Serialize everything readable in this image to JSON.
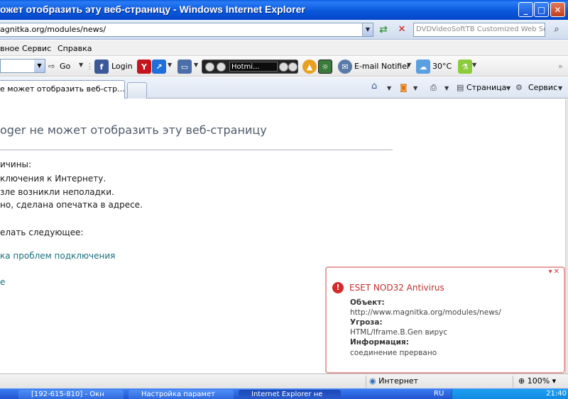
{
  "window": {
    "title": "ожет отобразить эту веб-страницу - Windows Internet Explorer",
    "minimize": "_",
    "maximize": "□",
    "close": "✕"
  },
  "address_bar": {
    "url": "agnitka.org/modules/news/",
    "search_placeholder": "DVDVideoSoftTB Customized Web Search"
  },
  "menu": {
    "items": [
      "вное",
      "Сервис",
      "Справка"
    ]
  },
  "toolbar": {
    "go_label": "Go",
    "login_label": "Login",
    "radio_station": "Hotmi...",
    "email_label": "E-mail Notifier",
    "weather": "30°C"
  },
  "tabs": {
    "active_tab": "е может отобразить веб-стр...",
    "page_label": "Страница",
    "service_label": "Сервис"
  },
  "content": {
    "heading": "oger не может отобразить эту веб-страницу",
    "reasons_heading": "ичины:",
    "reasons": [
      "ключения к Интернету.",
      "зле возникли неполадки.",
      "но, сделана опечатка в адресе."
    ],
    "todo_heading": "елать следующее:",
    "diagnose_link": "ка проблем подключения",
    "more_link": "е"
  },
  "eset_popup": {
    "title": "ESET NOD32 Antivirus",
    "object_label": "Объект:",
    "object_value": "http://www.magnitka.org/modules/news/",
    "threat_label": "Угроза:",
    "threat_value": "HTML/Iframe.B.Gen вирус",
    "info_label": "Информация:",
    "info_value": "соединение прервано"
  },
  "status_bar": {
    "zone": "Интернет",
    "zoom": "100%"
  },
  "taskbar": {
    "items": [
      "[192-615-810] - Окн",
      "Настройка парамет",
      "Internet Explorer не"
    ],
    "lang": "RU",
    "clock": "21:40"
  },
  "colors": {
    "titlebar": "#0a58dc",
    "link": "#1a6e7e",
    "eset_title": "#c03030",
    "eset_border": "#e8a0a0"
  }
}
